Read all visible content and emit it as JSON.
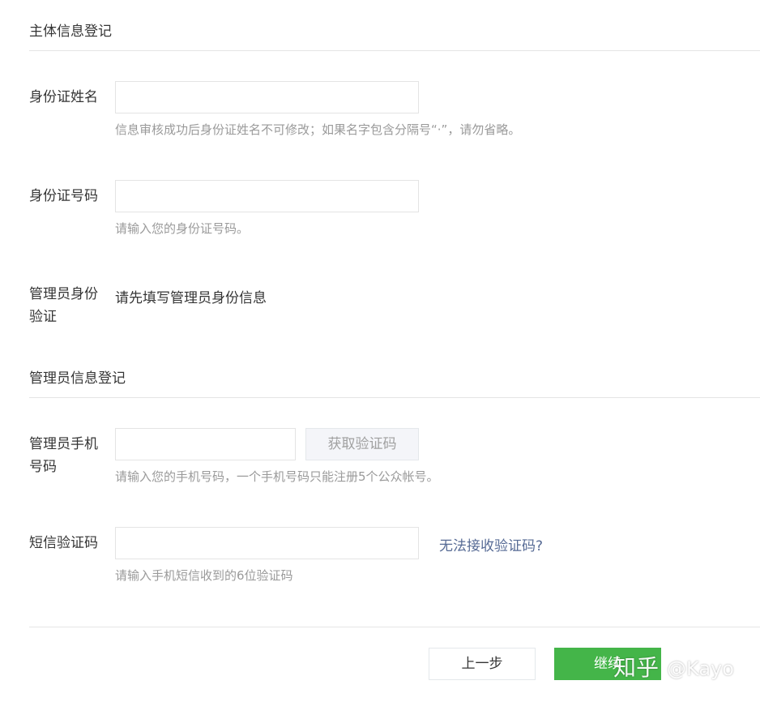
{
  "sections": {
    "subject_info": {
      "title": "主体信息登记"
    },
    "admin_info": {
      "title": "管理员信息登记"
    }
  },
  "fields": {
    "id_name": {
      "label": "身份证姓名",
      "value": "",
      "placeholder": "",
      "hint": "信息审核成功后身份证姓名不可修改；如果名字包含分隔号“·”，请勿省略。"
    },
    "id_number": {
      "label": "身份证号码",
      "value": "",
      "placeholder": "",
      "hint": "请输入您的身份证号码。"
    },
    "admin_verify": {
      "label_line1": "管理员身份",
      "label_line2": "验证",
      "value": "请先填写管理员身份信息"
    },
    "admin_phone": {
      "label_line1": "管理员手机",
      "label_line2": "号码",
      "value": "",
      "placeholder": "",
      "button": "获取验证码",
      "hint": "请输入您的手机号码，一个手机号码只能注册5个公众帐号。"
    },
    "sms_code": {
      "label": "短信验证码",
      "value": "",
      "placeholder": "",
      "link": "无法接收验证码?",
      "hint": "请输入手机短信收到的6位验证码"
    }
  },
  "footer": {
    "prev_button": "上一步",
    "next_button": "继续"
  },
  "watermark": {
    "brand": "知乎",
    "handle": "@Kayo"
  },
  "colors": {
    "primary": "#44b549",
    "link": "#576b95",
    "hint": "#9a9a9a",
    "border": "#e4e4e4"
  }
}
